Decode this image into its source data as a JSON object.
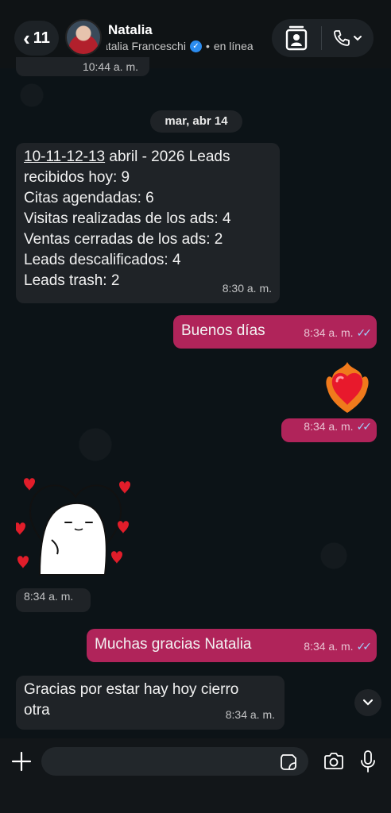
{
  "header": {
    "back_count": "11",
    "contact_name": "Natalia",
    "contact_full_name": "Natalia Franceschi",
    "status": "en línea"
  },
  "messages": {
    "partial_time": "10:44 a. m.",
    "date_divider": "mar, abr 14",
    "report": {
      "underlined": "10-11-12-13",
      "line1_rest": " abril - 2026 Leads",
      "line2": "recibidos hoy: 9",
      "line3": "Citas agendadas: 6",
      "line4": "Visitas realizadas de los ads: 4",
      "line5": "Ventas cerradas de los ads: 2",
      "line6": "Leads descalificados: 4",
      "line7": "Leads trash: 2",
      "time": "8:30 a. m."
    },
    "buenos_dias": {
      "text": "Buenos días",
      "time": "8:34 a. m."
    },
    "heart_msg": {
      "emoji_name": "heart-on-fire-icon",
      "time": "8:34 a. m."
    },
    "sticker_msg": {
      "time": "8:34 a. m."
    },
    "gracias_out": {
      "text": "Muchas gracias Natalia",
      "time": "8:34 a. m."
    },
    "gracias_in": {
      "line1": "Gracias por estar hay hoy cierro",
      "line2": "otra",
      "time": "8:34 a. m."
    }
  },
  "composer": {
    "placeholder": ""
  },
  "colors": {
    "outgoing": "#b0245a",
    "incoming": "#1f2327",
    "read_ticks": "#9fd0ff"
  }
}
